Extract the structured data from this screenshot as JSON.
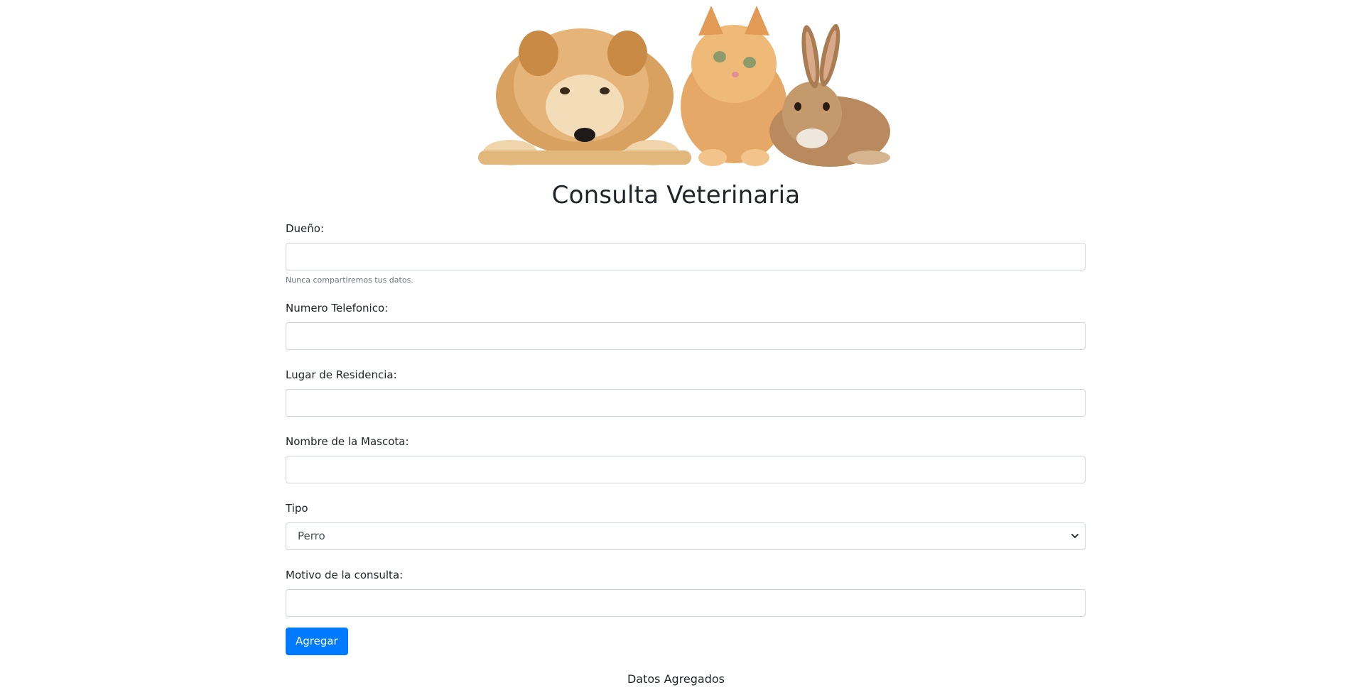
{
  "header": {
    "image_alt": "Perro, gato y conejo"
  },
  "page": {
    "title": "Consulta Veterinaria"
  },
  "form": {
    "owner": {
      "label": "Dueño:",
      "value": "",
      "placeholder": "",
      "help": "Nunca compartiremos tus datos."
    },
    "phone": {
      "label": "Numero Telefonico:",
      "value": "",
      "placeholder": ""
    },
    "residence": {
      "label": "Lugar de Residencia:",
      "value": "",
      "placeholder": ""
    },
    "pet_name": {
      "label": "Nombre de la Mascota:",
      "value": "",
      "placeholder": ""
    },
    "type": {
      "label": "Tipo",
      "selected": "Perro"
    },
    "reason": {
      "label": "Motivo de la consulta:",
      "value": "",
      "placeholder": ""
    },
    "submit_label": "Agregar"
  },
  "results": {
    "heading": "Datos Agregados"
  },
  "colors": {
    "primary": "#007bff",
    "border": "#ced4da",
    "text": "#212529",
    "muted": "#6c757d"
  }
}
